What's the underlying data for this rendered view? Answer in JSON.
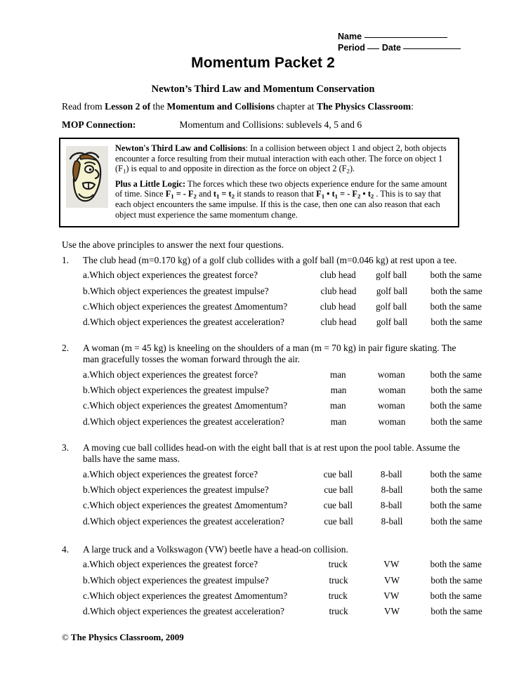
{
  "header": {
    "name_label": "Name",
    "period_label": "Period",
    "date_label": "Date"
  },
  "title": "Momentum Packet 2",
  "subtitle": "Newton’s Third Law and Momentum Conservation",
  "read_line": {
    "part1": "Read from ",
    "bold1": "Lesson 2 of",
    "part2": " the ",
    "bold2": "Momentum and Collisions",
    "part3": " chapter at ",
    "bold3": "The Physics Classroom",
    "part4": ":"
  },
  "mop": {
    "label": "MOP Connection:",
    "value": "Momentum and Collisions:  sublevels 4, 5 and 6"
  },
  "principle_box": {
    "p1_bold": "Newton's Third Law and Collisions",
    "p1_text": ":  In a collision between object 1 and object 2, both objects encounter a force resulting from their mutual interaction with each other.  The force on object 1 (F",
    "p1_sub1": "1",
    "p1_text2": ") is equal to and opposite in direction as the force on object 2 (F",
    "p1_sub2": "2",
    "p1_text3": ").",
    "p2_bold": "Plus a Little Logic:",
    "p2_text1": "  The forces which these two objects experience endure for the same amount of time.  Since ",
    "p2_eq1": "F",
    "p2_eq1_sub": "1",
    "p2_eq2": " = - F",
    "p2_eq2_sub": "2",
    "p2_text2": " and ",
    "p2_eq3": "t",
    "p2_eq3_sub": "1",
    "p2_eq4": " = t",
    "p2_eq4_sub": "2",
    "p2_text3": " it stands to reason that ",
    "p2_eq5": "F",
    "p2_eq5_sub": "1",
    "p2_eq6": " • t",
    "p2_eq6_sub": "1",
    "p2_eq7": " = - F",
    "p2_eq7_sub": "2",
    "p2_eq8": " • t",
    "p2_eq8_sub": "2",
    "p2_text4": " .  This is to say that each object encounters the same impulse.  If this is the case, then one can also reason that each object must experience the same momentum change."
  },
  "instruction": "Use the above principles to answer the next four questions.",
  "row_prompts": {
    "a": "Which object experiences the greatest force?",
    "b": "Which object experiences the greatest impulse?",
    "c": "Which object experiences the greatest Δmomentum?",
    "d": "Which object experiences the greatest acceleration?"
  },
  "questions": [
    {
      "number": "1.",
      "stem": "The club head (m=0.170 kg) of a golf club collides with a golf ball (m=0.046 kg) at rest upon a tee.",
      "letters": [
        "a.",
        "b.",
        "c.",
        "d."
      ],
      "prompts": [
        "Which object experiences the greatest force?",
        "Which object experiences the greatest impulse?",
        "Which object experiences the greatest Δmomentum?",
        "Which object experiences the greatest acceleration?"
      ],
      "options": [
        "club head",
        "golf ball",
        "both the same"
      ]
    },
    {
      "number": "2.",
      "stem": "A woman (m = 45 kg) is kneeling on the shoulders of a man (m = 70 kg) in pair figure skating.  The man gracefully tosses the woman forward through the air.",
      "letters": [
        "a.",
        "b.",
        "c.",
        "d."
      ],
      "prompts": [
        "Which object experiences the greatest force?",
        "Which object experiences the greatest impulse?",
        "Which object experiences the greatest Δmomentum?",
        "Which object experiences the greatest acceleration?"
      ],
      "options": [
        "man",
        "woman",
        "both the same"
      ]
    },
    {
      "number": "3.",
      "stem": "A moving cue ball collides head-on with the eight ball that is at rest upon the pool table.  Assume the balls have the same mass.",
      "letters": [
        "a.",
        "b.",
        "c.",
        "d."
      ],
      "prompts": [
        "Which object experiences the greatest force?",
        "Which object experiences the greatest impulse?",
        "Which object experiences the greatest Δmomentum?",
        "Which object experiences the greatest acceleration?"
      ],
      "options": [
        "cue ball",
        "8-ball",
        "both the same"
      ]
    },
    {
      "number": "4.",
      "stem": "A large truck and a Volkswagon (VW) beetle have a head-on collision.",
      "letters": [
        "a.",
        "b.",
        "c.",
        "d."
      ],
      "prompts": [
        "Which object experiences the greatest force?",
        "Which object experiences the greatest impulse?",
        "Which object experiences the greatest Δmomentum?",
        "Which object experiences the greatest acceleration?"
      ],
      "options": [
        "truck",
        "VW",
        "both the same"
      ]
    }
  ],
  "footer": {
    "mark": "©",
    "text": "The Physics Classroom, 2009"
  }
}
